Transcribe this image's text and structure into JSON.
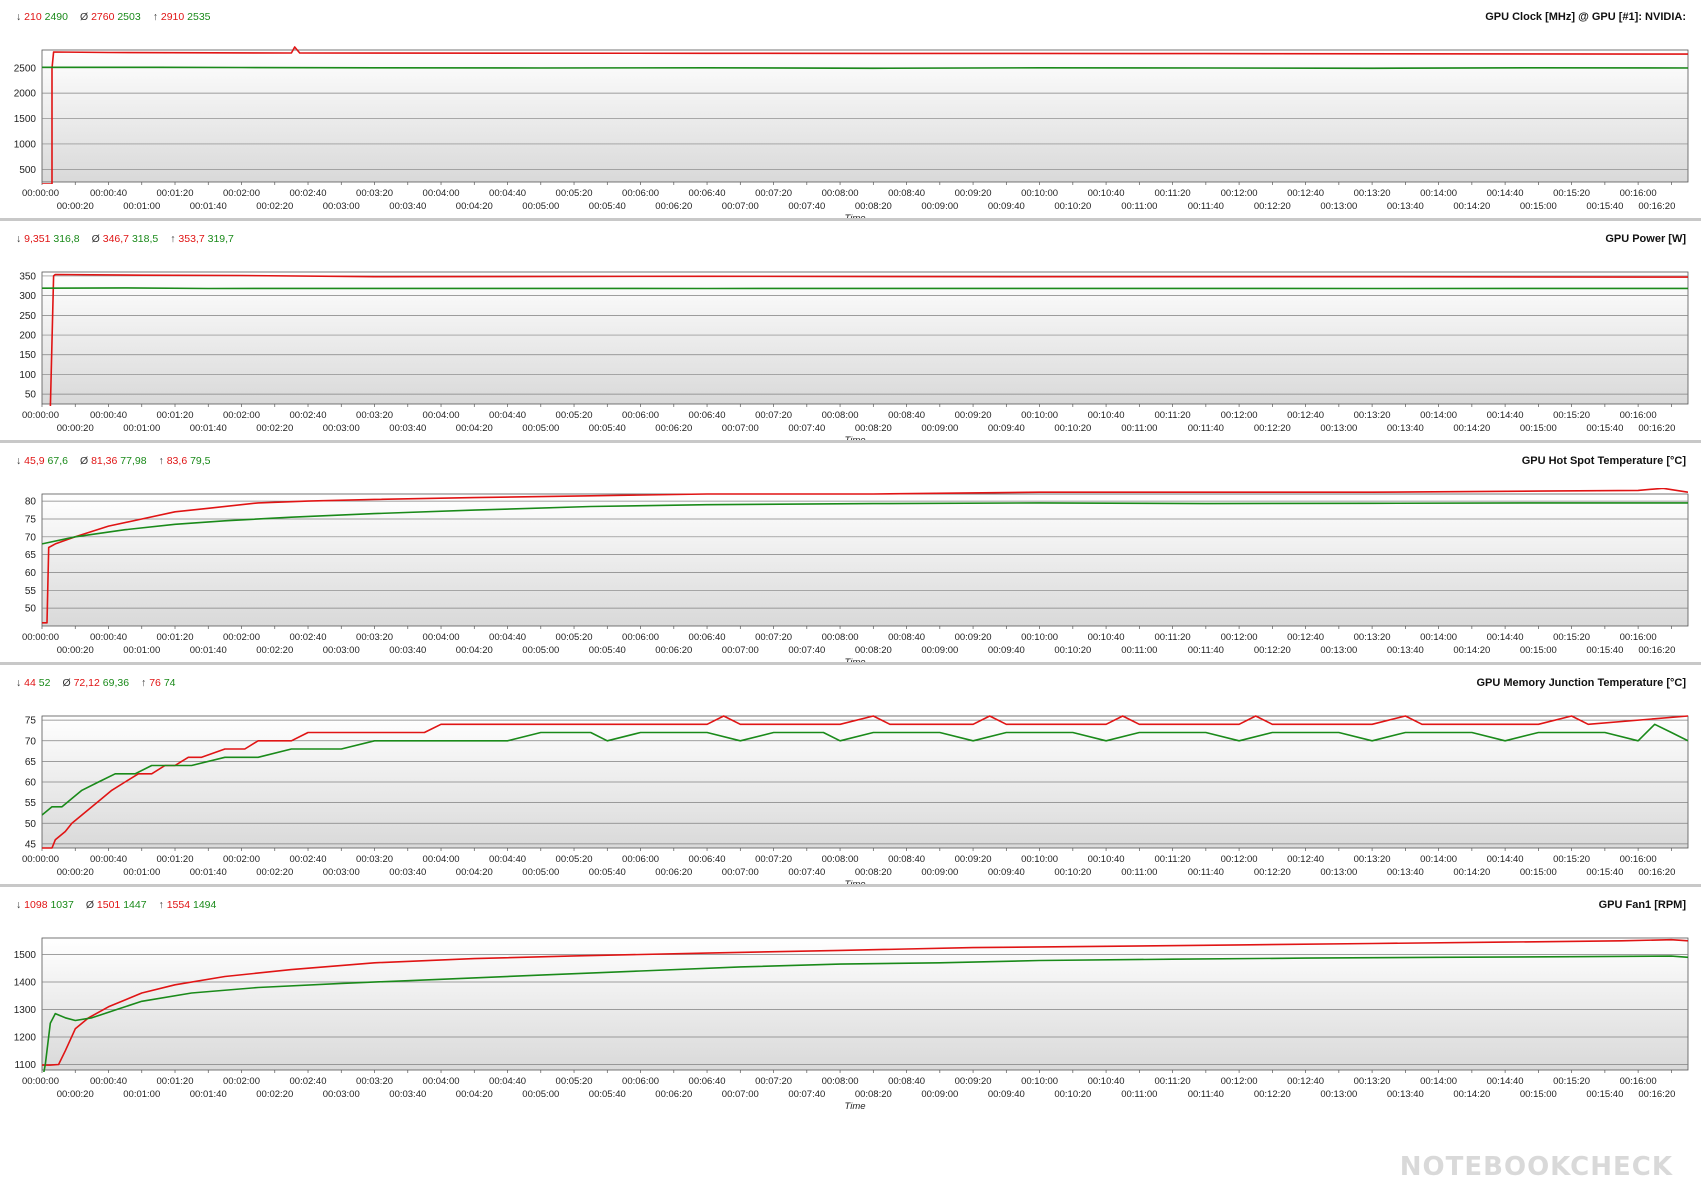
{
  "colors": {
    "series1": "#e01414",
    "series2": "#1a8a1a",
    "plot_top": "#ffffff",
    "plot_bottom": "#d9d9d9",
    "grid": "#808080"
  },
  "x_axis": {
    "label": "Time",
    "ticks": [
      "00:00:00",
      "00:00:20",
      "00:00:40",
      "00:01:00",
      "00:01:20",
      "00:01:40",
      "00:02:00",
      "00:02:20",
      "00:02:40",
      "00:03:00",
      "00:03:20",
      "00:03:40",
      "00:04:00",
      "00:04:20",
      "00:04:40",
      "00:05:00",
      "00:05:20",
      "00:05:40",
      "00:06:00",
      "00:06:20",
      "00:06:40",
      "00:07:00",
      "00:07:20",
      "00:07:40",
      "00:08:00",
      "00:08:20",
      "00:08:40",
      "00:09:00",
      "00:09:20",
      "00:09:40",
      "00:10:00",
      "00:10:20",
      "00:10:40",
      "00:11:00",
      "00:11:20",
      "00:11:40",
      "00:12:00",
      "00:12:20",
      "00:12:40",
      "00:13:00",
      "00:13:20",
      "00:13:40",
      "00:14:00",
      "00:14:20",
      "00:14:40",
      "00:15:00",
      "00:15:20",
      "00:15:40",
      "00:16:00",
      "00:16:20"
    ],
    "range_seconds": [
      0,
      990
    ]
  },
  "stat_symbols": {
    "min": "↓",
    "avg": "Ø",
    "max": "↑"
  },
  "chart_data": [
    {
      "type": "line",
      "title": "GPU Clock [MHz] @ GPU [#1]: NVIDIA:",
      "xlabel": "Time",
      "ylim": [
        250,
        2850
      ],
      "yticks": [
        500,
        1000,
        1500,
        2000,
        2500
      ],
      "stats": {
        "min": [
          "210",
          "2490"
        ],
        "avg": [
          "2760",
          "2503"
        ],
        "max": [
          "2910",
          "2535"
        ]
      },
      "series": [
        {
          "color": "#e01414",
          "points": [
            [
              0,
              210
            ],
            [
              6,
              210
            ],
            [
              6,
              2490
            ],
            [
              7,
              2810
            ],
            [
              40,
              2800
            ],
            [
              150,
              2790
            ],
            [
              152,
              2910
            ],
            [
              155,
              2790
            ],
            [
              400,
              2785
            ],
            [
              700,
              2780
            ],
            [
              990,
              2770
            ]
          ]
        },
        {
          "color": "#1a8a1a",
          "points": [
            [
              0,
              2510
            ],
            [
              70,
              2510
            ],
            [
              120,
              2505
            ],
            [
              200,
              2500
            ],
            [
              300,
              2495
            ],
            [
              400,
              2500
            ],
            [
              500,
              2490
            ],
            [
              600,
              2500
            ],
            [
              700,
              2495
            ],
            [
              800,
              2490
            ],
            [
              900,
              2500
            ],
            [
              990,
              2495
            ]
          ]
        }
      ]
    },
    {
      "type": "line",
      "title": "GPU Power [W]",
      "xlabel": "Time",
      "ylim": [
        25,
        360
      ],
      "yticks": [
        50,
        100,
        150,
        200,
        250,
        300,
        350
      ],
      "stats": {
        "min": [
          "9,351",
          "316,8"
        ],
        "avg": [
          "346,7",
          "318,5"
        ],
        "max": [
          "353,7",
          "319,7"
        ]
      },
      "series": [
        {
          "color": "#e01414",
          "points": [
            [
              0,
              9.4
            ],
            [
              5,
              9.4
            ],
            [
              7,
              350
            ],
            [
              8,
              353.7
            ],
            [
              60,
              352
            ],
            [
              120,
              351
            ],
            [
              200,
              348
            ],
            [
              400,
              349
            ],
            [
              600,
              348
            ],
            [
              800,
              348
            ],
            [
              990,
              347
            ]
          ]
        },
        {
          "color": "#1a8a1a",
          "points": [
            [
              0,
              319
            ],
            [
              50,
              319.7
            ],
            [
              100,
              318
            ],
            [
              200,
              318.5
            ],
            [
              400,
              318
            ],
            [
              600,
              318.5
            ],
            [
              800,
              318
            ],
            [
              990,
              318.5
            ]
          ]
        }
      ]
    },
    {
      "type": "line",
      "title": "GPU Hot Spot Temperature [°C]",
      "xlabel": "Time",
      "ylim": [
        45,
        82
      ],
      "yticks": [
        50,
        55,
        60,
        65,
        70,
        75,
        80
      ],
      "stats": {
        "min": [
          "45,9",
          "67,6"
        ],
        "avg": [
          "81,36",
          "77,98"
        ],
        "max": [
          "83,6",
          "79,5"
        ]
      },
      "series": [
        {
          "color": "#e01414",
          "points": [
            [
              0,
              45.9
            ],
            [
              3,
              45.9
            ],
            [
              4,
              67
            ],
            [
              8,
              68
            ],
            [
              20,
              70
            ],
            [
              40,
              73
            ],
            [
              60,
              75
            ],
            [
              80,
              77
            ],
            [
              100,
              78
            ],
            [
              130,
              79.5
            ],
            [
              160,
              80
            ],
            [
              200,
              80.5
            ],
            [
              260,
              81
            ],
            [
              330,
              81.5
            ],
            [
              400,
              82
            ],
            [
              500,
              82
            ],
            [
              600,
              82.5
            ],
            [
              700,
              82.5
            ],
            [
              800,
              82.5
            ],
            [
              900,
              82.8
            ],
            [
              960,
              83
            ],
            [
              975,
              83.6
            ],
            [
              990,
              82.5
            ]
          ]
        },
        {
          "color": "#1a8a1a",
          "points": [
            [
              0,
              68
            ],
            [
              20,
              70
            ],
            [
              50,
              72
            ],
            [
              80,
              73.5
            ],
            [
              110,
              74.5
            ],
            [
              150,
              75.5
            ],
            [
              200,
              76.5
            ],
            [
              260,
              77.5
            ],
            [
              330,
              78.5
            ],
            [
              400,
              79
            ],
            [
              500,
              79.3
            ],
            [
              600,
              79.5
            ],
            [
              700,
              79.3
            ],
            [
              800,
              79.4
            ],
            [
              900,
              79.5
            ],
            [
              990,
              79.5
            ]
          ]
        }
      ]
    },
    {
      "type": "line",
      "title": "GPU Memory Junction Temperature [°C]",
      "xlabel": "Time",
      "ylim": [
        44,
        76
      ],
      "yticks": [
        45,
        50,
        55,
        60,
        65,
        70,
        75
      ],
      "stats": {
        "min": [
          "44",
          "52"
        ],
        "avg": [
          "72,12",
          "69,36"
        ],
        "max": [
          "76",
          "74"
        ]
      },
      "series": [
        {
          "color": "#e01414",
          "points": [
            [
              0,
              44
            ],
            [
              6,
              44
            ],
            [
              8,
              46
            ],
            [
              14,
              48
            ],
            [
              18,
              50
            ],
            [
              24,
              52
            ],
            [
              30,
              54
            ],
            [
              36,
              56
            ],
            [
              42,
              58
            ],
            [
              50,
              60
            ],
            [
              58,
              62
            ],
            [
              66,
              62
            ],
            [
              74,
              64
            ],
            [
              80,
              64
            ],
            [
              88,
              66
            ],
            [
              96,
              66
            ],
            [
              110,
              68
            ],
            [
              122,
              68
            ],
            [
              130,
              70
            ],
            [
              150,
              70
            ],
            [
              160,
              72
            ],
            [
              180,
              72
            ],
            [
              200,
              72
            ],
            [
              220,
              72
            ],
            [
              230,
              72
            ],
            [
              240,
              74
            ],
            [
              300,
              74
            ],
            [
              360,
              74
            ],
            [
              400,
              74
            ],
            [
              410,
              76
            ],
            [
              420,
              74
            ],
            [
              480,
              74
            ],
            [
              500,
              76
            ],
            [
              510,
              74
            ],
            [
              560,
              74
            ],
            [
              570,
              76
            ],
            [
              580,
              74
            ],
            [
              640,
              74
            ],
            [
              650,
              76
            ],
            [
              660,
              74
            ],
            [
              720,
              74
            ],
            [
              730,
              76
            ],
            [
              740,
              74
            ],
            [
              800,
              74
            ],
            [
              820,
              76
            ],
            [
              830,
              74
            ],
            [
              900,
              74
            ],
            [
              920,
              76
            ],
            [
              930,
              74
            ],
            [
              990,
              76
            ]
          ]
        },
        {
          "color": "#1a8a1a",
          "points": [
            [
              0,
              52
            ],
            [
              6,
              54
            ],
            [
              12,
              54
            ],
            [
              18,
              56
            ],
            [
              24,
              58
            ],
            [
              34,
              60
            ],
            [
              44,
              62
            ],
            [
              56,
              62
            ],
            [
              66,
              64
            ],
            [
              90,
              64
            ],
            [
              110,
              66
            ],
            [
              130,
              66
            ],
            [
              150,
              68
            ],
            [
              180,
              68
            ],
            [
              200,
              70
            ],
            [
              240,
              70
            ],
            [
              280,
              70
            ],
            [
              300,
              72
            ],
            [
              330,
              72
            ],
            [
              340,
              70
            ],
            [
              360,
              72
            ],
            [
              400,
              72
            ],
            [
              420,
              70
            ],
            [
              440,
              72
            ],
            [
              470,
              72
            ],
            [
              480,
              70
            ],
            [
              500,
              72
            ],
            [
              540,
              72
            ],
            [
              560,
              70
            ],
            [
              580,
              72
            ],
            [
              620,
              72
            ],
            [
              640,
              70
            ],
            [
              660,
              72
            ],
            [
              700,
              72
            ],
            [
              720,
              70
            ],
            [
              740,
              72
            ],
            [
              780,
              72
            ],
            [
              800,
              70
            ],
            [
              820,
              72
            ],
            [
              860,
              72
            ],
            [
              880,
              70
            ],
            [
              900,
              72
            ],
            [
              940,
              72
            ],
            [
              960,
              70
            ],
            [
              970,
              74
            ],
            [
              980,
              72
            ],
            [
              990,
              70
            ]
          ]
        }
      ]
    },
    {
      "type": "line",
      "title": "GPU Fan1 [RPM]",
      "xlabel": "Time",
      "ylim": [
        1080,
        1560
      ],
      "yticks": [
        1100,
        1200,
        1300,
        1400,
        1500
      ],
      "stats": {
        "min": [
          "1098",
          "1037"
        ],
        "avg": [
          "1501",
          "1447"
        ],
        "max": [
          "1554",
          "1494"
        ]
      },
      "series": [
        {
          "color": "#e01414",
          "points": [
            [
              0,
              1098
            ],
            [
              5,
              1098
            ],
            [
              10,
              1100
            ],
            [
              14,
              1150
            ],
            [
              20,
              1230
            ],
            [
              28,
              1270
            ],
            [
              40,
              1310
            ],
            [
              60,
              1360
            ],
            [
              80,
              1390
            ],
            [
              110,
              1420
            ],
            [
              150,
              1445
            ],
            [
              200,
              1470
            ],
            [
              260,
              1485
            ],
            [
              320,
              1495
            ],
            [
              400,
              1505
            ],
            [
              480,
              1515
            ],
            [
              560,
              1525
            ],
            [
              640,
              1530
            ],
            [
              720,
              1535
            ],
            [
              800,
              1540
            ],
            [
              880,
              1545
            ],
            [
              950,
              1550
            ],
            [
              980,
              1554
            ],
            [
              990,
              1550
            ]
          ]
        },
        {
          "color": "#1a8a1a",
          "points": [
            [
              0,
              1037
            ],
            [
              2,
              1100
            ],
            [
              5,
              1250
            ],
            [
              8,
              1285
            ],
            [
              14,
              1270
            ],
            [
              20,
              1260
            ],
            [
              30,
              1270
            ],
            [
              45,
              1300
            ],
            [
              60,
              1330
            ],
            [
              90,
              1360
            ],
            [
              130,
              1380
            ],
            [
              180,
              1395
            ],
            [
              240,
              1410
            ],
            [
              300,
              1425
            ],
            [
              360,
              1440
            ],
            [
              420,
              1455
            ],
            [
              480,
              1465
            ],
            [
              540,
              1470
            ],
            [
              600,
              1478
            ],
            [
              680,
              1483
            ],
            [
              760,
              1487
            ],
            [
              840,
              1490
            ],
            [
              920,
              1492
            ],
            [
              980,
              1494
            ],
            [
              990,
              1490
            ]
          ]
        }
      ]
    }
  ]
}
